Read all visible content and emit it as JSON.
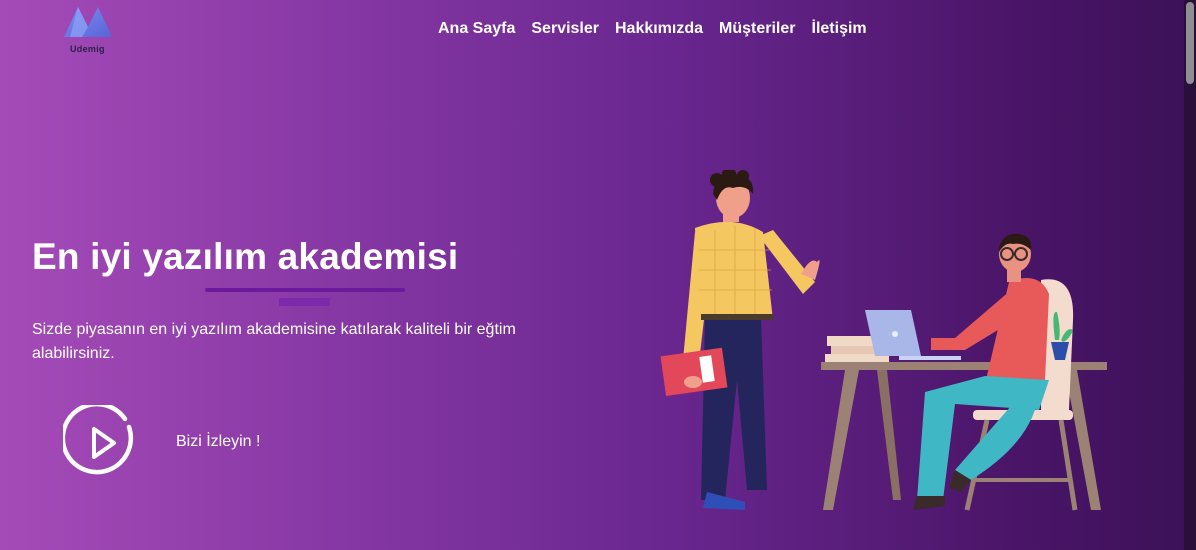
{
  "brand": {
    "name": "Udemig",
    "logo_icon": "mountain-m-logo"
  },
  "nav": {
    "items": [
      {
        "label": "Ana Sayfa"
      },
      {
        "label": "Servisler"
      },
      {
        "label": "Hakkımızda"
      },
      {
        "label": "Müşteriler"
      },
      {
        "label": "İletişim"
      }
    ]
  },
  "hero": {
    "title": "En iyi yazılım akademisi",
    "description": "Sizde piyasanın en iyi yazılım akademisine katılarak kaliteli bir eğtim alabilirsiniz.",
    "watch_label": "Bizi İzleyin !",
    "play_icon": "play-circle-icon"
  },
  "colors": {
    "gradient_start": "#a54bb8",
    "gradient_end": "#3c1158",
    "accent_line": "#6a1a9a"
  }
}
